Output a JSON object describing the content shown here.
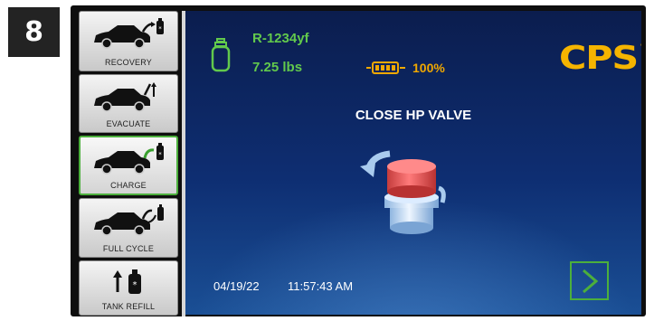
{
  "step_number": "8",
  "sidebar": {
    "items": [
      {
        "label": "RECOVERY",
        "icon": "car-recovery-icon"
      },
      {
        "label": "EVACUATE",
        "icon": "car-evacuate-icon"
      },
      {
        "label": "CHARGE",
        "icon": "car-charge-icon",
        "active": true
      },
      {
        "label": "FULL CYCLE",
        "icon": "car-full-cycle-icon"
      },
      {
        "label": "TANK REFILL",
        "icon": "tank-refill-icon"
      }
    ]
  },
  "status": {
    "refrigerant": "R-1234yf",
    "tank_weight": "7.25 lbs",
    "battery_percent": "100%"
  },
  "brand": {
    "logo_text": "CPS"
  },
  "instruction": "CLOSE HP VALVE",
  "footer": {
    "date": "04/19/22",
    "time": "11:57:43 AM"
  },
  "colors": {
    "accent_green": "#62c94c",
    "brand_yellow": "#f5b400",
    "screen_blue": "#0e2e72"
  }
}
